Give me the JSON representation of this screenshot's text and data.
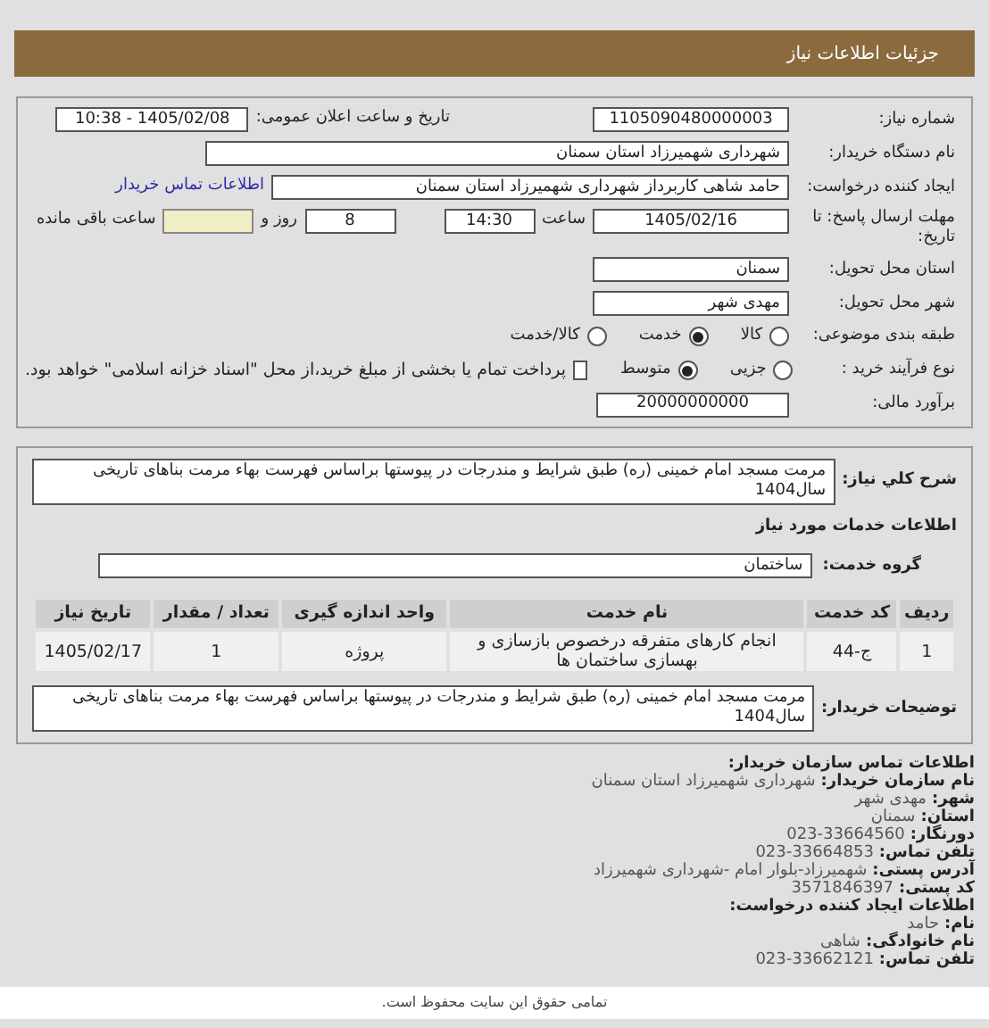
{
  "header": {
    "title": "جزئیات اطلاعات نیاز"
  },
  "details": {
    "need_number": {
      "label": "شماره نیاز:",
      "value": "1105090480000003"
    },
    "announce": {
      "label": "تاریخ و ساعت اعلان عمومی:",
      "value": "1405/02/08 - 10:38"
    },
    "buyer": {
      "label": "نام دستگاه خریدار:",
      "value": "شهرداری شهمیرزاد استان سمنان"
    },
    "creator": {
      "label": "ایجاد کننده درخواست:",
      "value": "حامد شاهی کاربرداز شهرداری شهمیرزاد استان سمنان",
      "link": "اطلاعات تماس خریدار"
    },
    "deadline": {
      "label": "مهلت ارسال پاسخ: تا تاریخ:",
      "date": "1405/02/16",
      "time_label": "ساعت",
      "time": "14:30",
      "days": "8",
      "days_label": "روز و",
      "remaining_label": "ساعت باقی مانده"
    },
    "province": {
      "label": "استان محل تحویل:",
      "value": "سمنان"
    },
    "city": {
      "label": "شهر محل تحویل:",
      "value": "مهدی شهر"
    },
    "category": {
      "label": "طبقه بندی موضوعی:",
      "options": [
        {
          "label": "کالا",
          "selected": false
        },
        {
          "label": "خدمت",
          "selected": true
        },
        {
          "label": "کالا/خدمت",
          "selected": false
        }
      ]
    },
    "process": {
      "label": "نوع فرآیند خرید :",
      "options": [
        {
          "label": "جزیی",
          "selected": false
        },
        {
          "label": "متوسط",
          "selected": true
        }
      ],
      "treasury": {
        "label": "پرداخت تمام یا بخشی از مبلغ خرید،از محل \"اسناد خزانه اسلامی\" خواهد بود.",
        "checked": false
      }
    },
    "estimate": {
      "label": "برآورد مالی:",
      "value": "20000000000"
    }
  },
  "need": {
    "description": {
      "label": "شرح کلي نياز:",
      "value": "مرمت مسجد امام خمینی (ره) طبق شرایط و مندرجات در پیوستها براساس فهرست بهاء مرمت بناهای تاریخی سال1404"
    },
    "services_title": "اطلاعات خدمات مورد نیاز",
    "group": {
      "label": "گروه خدمت:",
      "value": "ساختمان"
    },
    "table": {
      "columns": [
        "ردیف",
        "کد خدمت",
        "نام خدمت",
        "واحد اندازه گیری",
        "تعداد / مقدار",
        "تاریخ نیاز"
      ],
      "rows": [
        [
          "1",
          "ج-44",
          "انجام کارهای متفرقه درخصوص بازسازی و بهسازی ساختمان ها",
          "پروژه",
          "1",
          "1405/02/17"
        ]
      ]
    },
    "buyer_notes": {
      "label": "توضیحات خریدار:",
      "value": "مرمت مسجد امام خمینی (ره) طبق شرایط و مندرجات در پیوستها براساس فهرست بهاء مرمت بناهای تاریخی سال1404"
    }
  },
  "contact": [
    {
      "kind": "heading",
      "label": "اطلاعات تماس سازمان خریدار:"
    },
    {
      "kind": "field",
      "label": "نام سازمان خریدار:",
      "value": "شهرداری شهمیرزاد استان سمنان"
    },
    {
      "kind": "field",
      "label": "شهر:",
      "value": "مهدی شهر"
    },
    {
      "kind": "field",
      "label": "استان:",
      "value": "سمنان"
    },
    {
      "kind": "field",
      "label": "دورنگار:",
      "value": "023-33664560"
    },
    {
      "kind": "field",
      "label": "تلفن تماس:",
      "value": "023-33664853"
    },
    {
      "kind": "field",
      "label": "آدرس پستی:",
      "value": "شهمیرزاد-بلوار امام -شهرداری شهمیرزاد"
    },
    {
      "kind": "field",
      "label": "کد پستی:",
      "value": "3571846397"
    },
    {
      "kind": "heading",
      "label": "اطلاعات ایجاد کننده درخواست:"
    },
    {
      "kind": "field",
      "label": "نام:",
      "value": "حامد"
    },
    {
      "kind": "field",
      "label": "نام خانوادگی:",
      "value": "شاهی"
    },
    {
      "kind": "field",
      "label": "تلفن تماس:",
      "value": "023-33662121"
    }
  ],
  "footer": "تمامی حقوق این سایت محفوظ است."
}
